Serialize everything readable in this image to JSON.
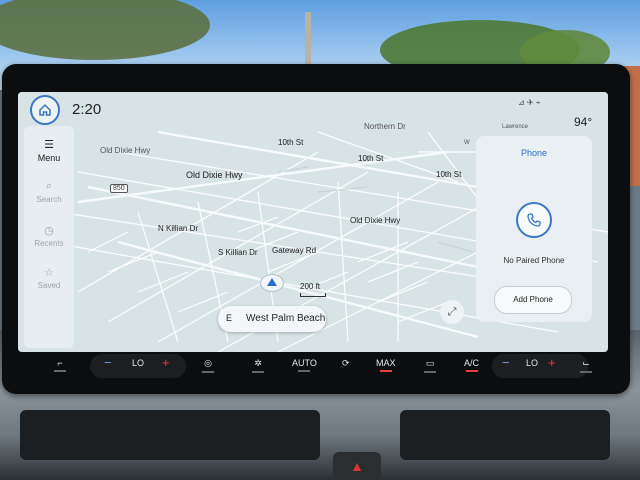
{
  "topbar": {
    "time": "2:20",
    "temperature": "94°",
    "status_icons": "⊿ ✈ ⌁"
  },
  "rail": {
    "items": [
      {
        "label": "Menu",
        "icon": "menu-icon"
      },
      {
        "label": "Search",
        "icon": "search-icon"
      },
      {
        "label": "Recents",
        "icon": "recents-icon"
      },
      {
        "label": "Saved",
        "icon": "star-icon"
      }
    ]
  },
  "map": {
    "labels": {
      "northern_dr": "Northern Dr",
      "tenth_a": "10th St",
      "tenth_b": "10th St",
      "tenth_c": "10th St",
      "old_dixie_a": "Old Dixie Hwy",
      "old_dixie_b": "Old Dixie Hwy",
      "old_dixie_c": "Old Dixie Hwy",
      "n_killian": "N Killian Dr",
      "s_killian": "S Killian Dr",
      "gateway": "Gateway Rd",
      "lawrence": "Lawrence",
      "w_label": "W"
    },
    "shield": "850",
    "scale": "200 ft",
    "heading": "E",
    "destination": "West Palm Beach"
  },
  "phone": {
    "title": "Phone",
    "status": "No Paired Phone",
    "add_label": "Add Phone"
  },
  "climate": {
    "left_temp": "LO",
    "right_temp": "LO",
    "auto": "AUTO",
    "max": "MAX",
    "ac": "A/C",
    "minus": "−",
    "plus": "+"
  },
  "colors": {
    "accent": "#3a78c5",
    "heat": "#e04040",
    "cool": "#6f9fe0"
  }
}
